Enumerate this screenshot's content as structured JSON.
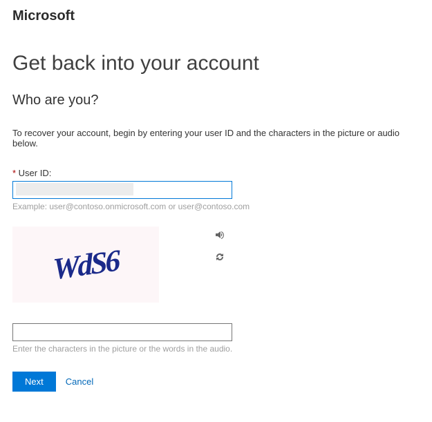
{
  "brand": "Microsoft",
  "title": "Get back into your account",
  "subtitle": "Who are you?",
  "instructions": "To recover your account, begin by entering your user ID and the characters in the picture or audio below.",
  "userIdLabel": "User ID:",
  "userIdValue": "",
  "userIdHint": "Example: user@contoso.onmicrosoft.com or user@contoso.com",
  "captchaText": "WdS6",
  "captchaInputValue": "",
  "captchaHint": "Enter the characters in the picture or the words in the audio.",
  "buttons": {
    "next": "Next",
    "cancel": "Cancel"
  }
}
